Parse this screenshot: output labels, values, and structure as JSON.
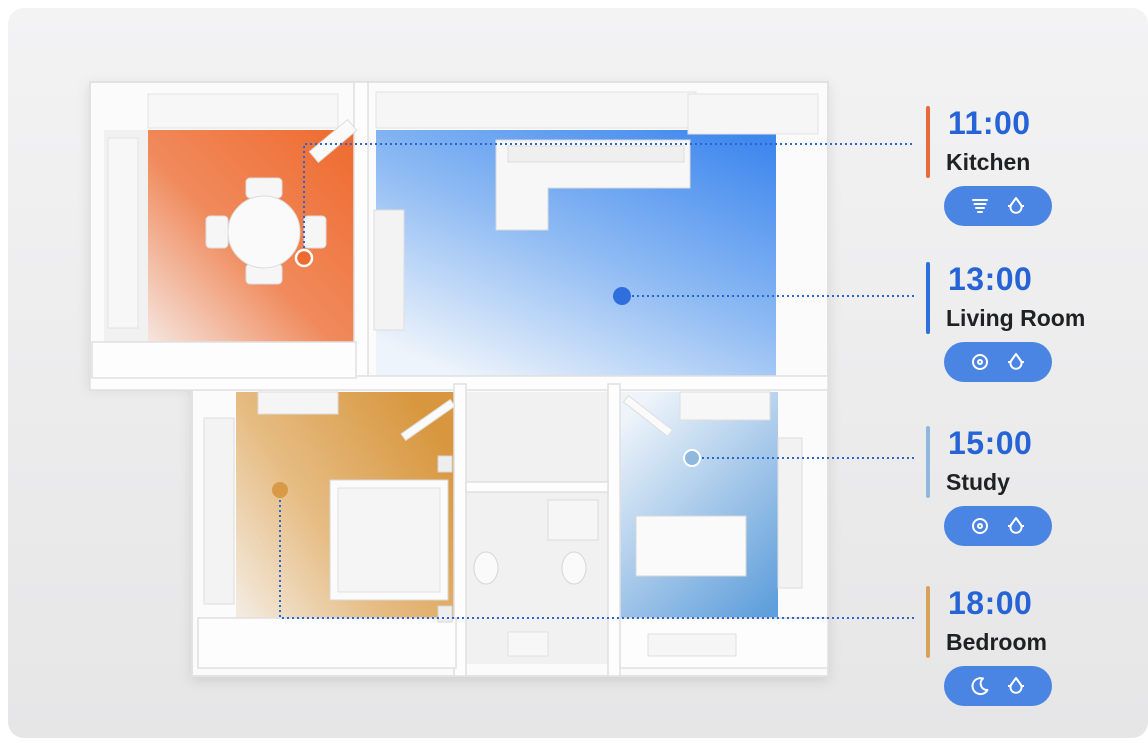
{
  "schedule": [
    {
      "time": "11:00",
      "room": "Kitchen",
      "accent": "#e8693a",
      "modes": [
        "tornado-icon",
        "water-drop-icon"
      ]
    },
    {
      "time": "13:00",
      "room": "Living Room",
      "accent": "#2f6fdd",
      "modes": [
        "swirl-icon",
        "water-drop-icon"
      ]
    },
    {
      "time": "15:00",
      "room": "Study",
      "accent": "#8fb8df",
      "modes": [
        "swirl-icon",
        "water-drop-icon"
      ]
    },
    {
      "time": "18:00",
      "room": "Bedroom",
      "accent": "#d9a25a",
      "modes": [
        "moon-icon",
        "water-drop-icon"
      ]
    }
  ],
  "colors": {
    "time_text": "#2563d6",
    "pill": "#4a85e3",
    "kitchen": "#ee6a2f",
    "living": "#4a90ef",
    "study": "#6ea7dd",
    "bedroom": "#d99a45"
  }
}
